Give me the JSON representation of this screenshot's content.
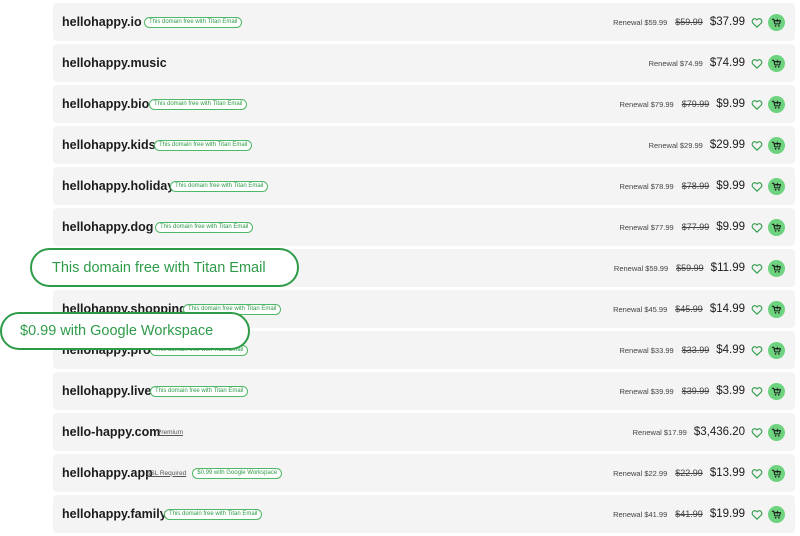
{
  "rows": [
    {
      "domain": "hellohappy.io",
      "tags": [
        {
          "type": "pill",
          "text": "This domain free with Titan Email"
        }
      ],
      "renewal": "Renewal $59.99",
      "old_price": "$59.99",
      "price": "$37.99"
    },
    {
      "domain": "hellohappy.music",
      "tags": [],
      "renewal": "Renewal $74.99",
      "old_price": "",
      "price": "$74.99"
    },
    {
      "domain": "hellohappy.bio",
      "tags": [
        {
          "type": "pill",
          "text": "This domain free with Titan Email"
        }
      ],
      "renewal": "Renewal $79.99",
      "old_price": "$79.99",
      "price": "$9.99"
    },
    {
      "domain": "hellohappy.kids",
      "tags": [
        {
          "type": "pill",
          "text": "This domain free with Titan Email"
        }
      ],
      "renewal": "Renewal $29.99",
      "old_price": "",
      "price": "$29.99"
    },
    {
      "domain": "hellohappy.holiday",
      "tags": [
        {
          "type": "pill",
          "text": "This domain free with Titan Email"
        }
      ],
      "renewal": "Renewal $78.99",
      "old_price": "$78.99",
      "price": "$9.99"
    },
    {
      "domain": "hellohappy.dog",
      "tags": [
        {
          "type": "pill",
          "text": "This domain free with Titan Email"
        }
      ],
      "renewal": "Renewal $77.99",
      "old_price": "$77.99",
      "price": "$9.99"
    },
    {
      "domain": "",
      "tags": [],
      "renewal": "Renewal $59.99",
      "old_price": "$59.99",
      "price": "$11.99"
    },
    {
      "domain": "hellohappy.shopping",
      "tags": [
        {
          "type": "pill",
          "text": "This domain free with Titan Email"
        }
      ],
      "renewal": "Renewal $45.99",
      "old_price": "$45.99",
      "price": "$14.99"
    },
    {
      "domain": "hellohappy.pro",
      "tags": [
        {
          "type": "pill",
          "text": "This domain free with Titan Email"
        }
      ],
      "renewal": "Renewal $33.99",
      "old_price": "$33.99",
      "price": "$4.99"
    },
    {
      "domain": "hellohappy.live",
      "tags": [
        {
          "type": "pill",
          "text": "This domain free with Titan Email"
        }
      ],
      "renewal": "Renewal $39.99",
      "old_price": "$39.99",
      "price": "$3.99"
    },
    {
      "domain": "hello-happy.com",
      "tags": [
        {
          "type": "link",
          "text": "Premium"
        }
      ],
      "renewal": "Renewal $17.99",
      "old_price": "",
      "price": "$3,436.20"
    },
    {
      "domain": "hellohappy.app",
      "tags": [
        {
          "type": "link",
          "text": "SSL Required"
        },
        {
          "type": "pill",
          "text": "$0.99 with Google Workspace"
        }
      ],
      "renewal": "Renewal $22.99",
      "old_price": "$22.99",
      "price": "$13.99"
    },
    {
      "domain": "hellohappy.family",
      "tags": [
        {
          "type": "pill",
          "text": "This domain free with Titan Email"
        }
      ],
      "renewal": "Renewal $41.99",
      "old_price": "$41.99",
      "price": "$19.99"
    }
  ],
  "callouts": {
    "titan": "This domain free with Titan Email",
    "google": "$0.99 with Google Workspace"
  },
  "icons": {
    "heart": "heart-outline-icon",
    "cart": "cart-icon"
  },
  "colors": {
    "accent_green": "#2e9b49",
    "cart_green": "#6ed37f",
    "row_background": "#f4f4f4"
  }
}
